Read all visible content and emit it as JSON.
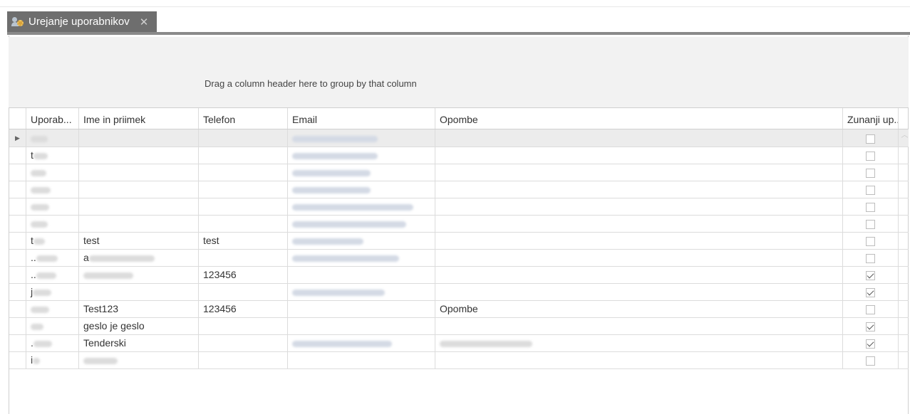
{
  "tab": {
    "title": "Urejanje uporabnikov",
    "close": "✕",
    "icon": "users-settings-icon"
  },
  "grid": {
    "group_hint": "Drag a column header here to group by that column",
    "columns": [
      "Uporab...",
      "Ime in priimek",
      "Telefon",
      "Email",
      "Opombe",
      "Zunanji up..."
    ],
    "rows": [
      {
        "user": "",
        "name": "",
        "phone": "",
        "email": "",
        "notes": "",
        "external": false,
        "selected": true
      },
      {
        "user": "t",
        "name": "",
        "phone": "",
        "email": "",
        "notes": "",
        "external": false
      },
      {
        "user": "",
        "name": "",
        "phone": "",
        "email": "",
        "notes": "",
        "external": false
      },
      {
        "user": "",
        "name": "",
        "phone": "",
        "email": "",
        "notes": "",
        "external": false
      },
      {
        "user": "",
        "name": "",
        "phone": "",
        "email": "",
        "notes": "",
        "external": false
      },
      {
        "user": "",
        "name": "",
        "phone": "",
        "email": "",
        "notes": "",
        "external": false
      },
      {
        "user": "t",
        "name": "test",
        "phone": "test",
        "email": "",
        "notes": "",
        "external": false
      },
      {
        "user": "..",
        "name": "a",
        "phone": "",
        "email": "",
        "notes": "",
        "external": false
      },
      {
        "user": "..",
        "name": "",
        "phone": "123456",
        "email": "",
        "notes": "",
        "external": true
      },
      {
        "user": "j",
        "name": "",
        "phone": "",
        "email": "",
        "notes": "",
        "external": true
      },
      {
        "user": "",
        "name": "Test123",
        "phone": "123456",
        "email": "",
        "notes": "Opombe",
        "external": false
      },
      {
        "user": "",
        "name": "geslo je geslo",
        "phone": "",
        "email": "",
        "notes": "",
        "external": true
      },
      {
        "user": ".",
        "name": "Tenderski",
        "phone": "",
        "email": "",
        "notes": "",
        "external": true
      },
      {
        "user": "i",
        "name": "",
        "phone": "",
        "email": "",
        "notes": "",
        "external": false
      }
    ]
  }
}
